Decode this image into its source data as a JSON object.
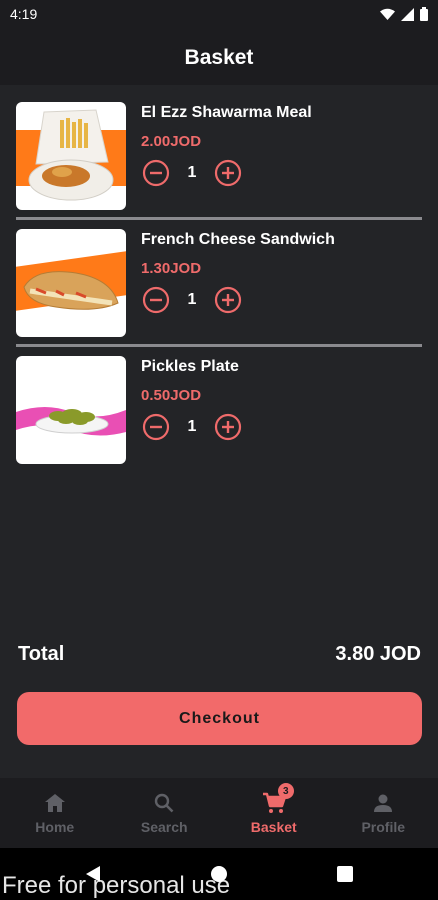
{
  "status_bar": {
    "time": "4:19"
  },
  "header": {
    "title": "Basket"
  },
  "items": [
    {
      "name": "El Ezz Shawarma Meal",
      "price": "2.00JOD",
      "quantity": "1"
    },
    {
      "name": "French Cheese Sandwich",
      "price": "1.30JOD",
      "quantity": "1"
    },
    {
      "name": "Pickles Plate",
      "price": "0.50JOD",
      "quantity": "1"
    }
  ],
  "summary": {
    "total_label": "Total",
    "total_value": "3.80 JOD"
  },
  "checkout": {
    "label": "Checkout"
  },
  "nav": {
    "home": "Home",
    "search": "Search",
    "basket": "Basket",
    "basket_badge": "3",
    "profile": "Profile"
  },
  "watermark": "Free for personal use",
  "colors": {
    "accent": "#ef6b6b",
    "checkout": "#f26a6a",
    "background": "#232427",
    "bar": "#1c1c1f"
  }
}
